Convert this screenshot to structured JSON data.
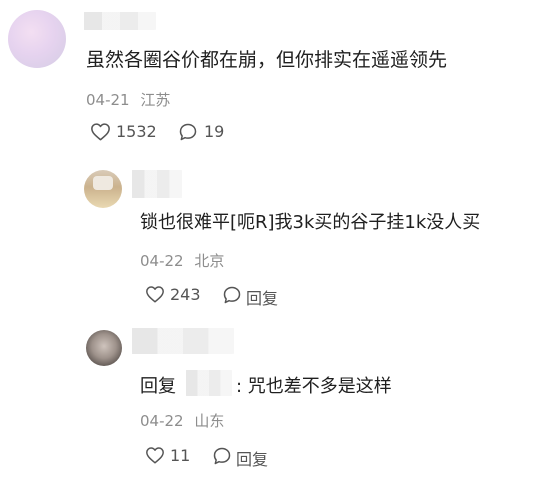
{
  "comments": [
    {
      "text": "虽然各圈谷价都在崩，但你排实在遥遥领先",
      "date": "04-21",
      "location": "江苏",
      "likes": "1532",
      "replies": "19"
    },
    {
      "text": "锁也很难平[呃R]我3k买的谷子挂1k没人买",
      "date": "04-22",
      "location": "北京",
      "likes": "243",
      "reply_label": "回复"
    },
    {
      "reply_prefix": "回复",
      "text": ": 咒也差不多是这样",
      "date": "04-22",
      "location": "山东",
      "likes": "11",
      "reply_label": "回复"
    }
  ],
  "icons": {
    "like": "heart-outline-icon",
    "comment": "speech-bubble-icon"
  },
  "colors": {
    "text": "#1f1f1f",
    "meta": "#8d8d8d",
    "icon": "#555555"
  }
}
